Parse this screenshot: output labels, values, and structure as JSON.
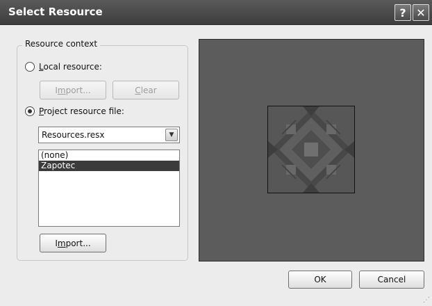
{
  "window": {
    "title": "Select Resource",
    "help_label": "?",
    "close_label": "✕"
  },
  "resource_context": {
    "label": "Resource context",
    "local_resource": {
      "label_prefix": "",
      "label_accel": "L",
      "label_rest": "ocal resource:",
      "selected": false
    },
    "import_top": {
      "prefix": "I",
      "accel": "m",
      "rest": "port...",
      "enabled": false
    },
    "clear": {
      "accel": "C",
      "rest": "lear",
      "enabled": false
    },
    "project_resource": {
      "label_accel": "P",
      "label_rest": "roject resource file:",
      "selected": true
    },
    "resx_dropdown": {
      "value": "Resources.resx",
      "arrow_icon": "chevron-down-icon"
    },
    "resources_list": [
      {
        "label": "(none)",
        "selected": false
      },
      {
        "label": "Zapotec",
        "selected": true
      }
    ],
    "import_bottom": {
      "prefix": "I",
      "accel": "m",
      "rest": "port..."
    }
  },
  "preview": {
    "image_name": "Zapotec"
  },
  "footer": {
    "ok_label": "OK",
    "cancel_label": "Cancel"
  }
}
